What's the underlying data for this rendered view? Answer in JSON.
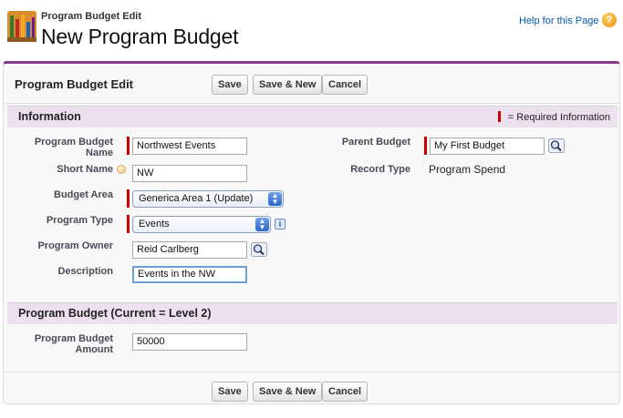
{
  "header": {
    "breadcrumb": "Program Budget Edit",
    "title": "New Program Budget",
    "help_link": "Help for this Page",
    "help_icon": "help-icon"
  },
  "edit": {
    "title": "Program Budget Edit",
    "buttons": {
      "save": "Save",
      "save_new": "Save & New",
      "cancel": "Cancel"
    }
  },
  "information": {
    "title": "Information",
    "required_legend": "= Required Information",
    "fields": {
      "name_label_line1": "Program Budget",
      "name_label_line2": "Name",
      "name_value": "Northwest Events",
      "short_name_label": "Short Name",
      "short_name_value": "NW",
      "budget_area_label": "Budget Area",
      "budget_area_value": "Generica Area 1 (Update)",
      "program_type_label": "Program Type",
      "program_type_value": "Events",
      "program_owner_label": "Program Owner",
      "program_owner_value": "Reid Carlberg",
      "description_label": "Description",
      "description_value": "Events in the NW",
      "parent_budget_label": "Parent Budget",
      "parent_budget_value": "My First Budget",
      "record_type_label": "Record Type",
      "record_type_value": "Program Spend"
    }
  },
  "budget_section": {
    "title": "Program Budget (Current = Level 2)",
    "amount_label_line1": "Program Budget",
    "amount_label_line2": "Amount",
    "amount_value": "50000"
  },
  "colors": {
    "accent": "#8a3a8a",
    "section_bg": "#ece0ef",
    "required": "#cc0000",
    "link": "#015ba7"
  }
}
